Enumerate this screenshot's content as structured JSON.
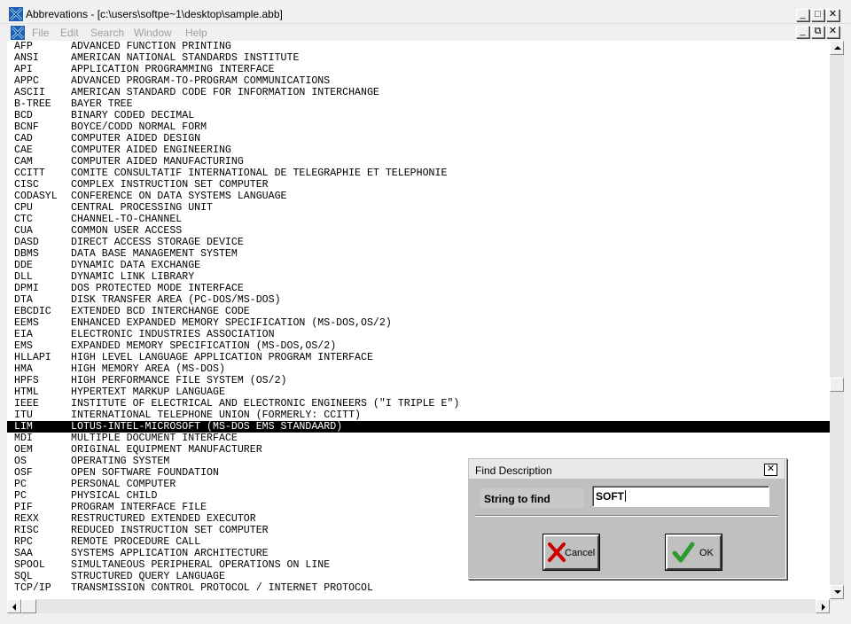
{
  "window": {
    "title": "Abbrevations - [c:\\users\\softpe~1\\desktop\\sample.abb]",
    "buttons": [
      "_",
      "□",
      "✕"
    ]
  },
  "menu": {
    "items": [
      "File",
      "Edit",
      "Search",
      "Window",
      "Help"
    ],
    "child_buttons": [
      "_",
      "⧉",
      "✕"
    ]
  },
  "entries": [
    {
      "abbr": "AFP",
      "desc": "ADVANCED FUNCTION PRINTING"
    },
    {
      "abbr": "ANSI",
      "desc": "AMERICAN NATIONAL STANDARDS INSTITUTE"
    },
    {
      "abbr": "API",
      "desc": "APPLICATION PROGRAMMING INTERFACE"
    },
    {
      "abbr": "APPC",
      "desc": "ADVANCED PROGRAM-TO-PROGRAM COMMUNICATIONS"
    },
    {
      "abbr": "ASCII",
      "desc": "AMERICAN STANDARD CODE FOR INFORMATION INTERCHANGE"
    },
    {
      "abbr": "B-TREE",
      "desc": "BAYER TREE"
    },
    {
      "abbr": "BCD",
      "desc": "BINARY CODED DECIMAL"
    },
    {
      "abbr": "BCNF",
      "desc": "BOYCE/CODD NORMAL FORM"
    },
    {
      "abbr": "CAD",
      "desc": "COMPUTER AIDED DESIGN"
    },
    {
      "abbr": "CAE",
      "desc": "COMPUTER AIDED ENGINEERING"
    },
    {
      "abbr": "CAM",
      "desc": "COMPUTER AIDED MANUFACTURING"
    },
    {
      "abbr": "CCITT",
      "desc": "COMITE CONSULTATIF INTERNATIONAL DE TELEGRAPHIE ET TELEPHONIE"
    },
    {
      "abbr": "CISC",
      "desc": "COMPLEX INSTRUCTION SET COMPUTER"
    },
    {
      "abbr": "CODASYL",
      "desc": "CONFERENCE ON DATA SYSTEMS LANGUAGE"
    },
    {
      "abbr": "CPU",
      "desc": "CENTRAL PROCESSING UNIT"
    },
    {
      "abbr": "CTC",
      "desc": "CHANNEL-TO-CHANNEL"
    },
    {
      "abbr": "CUA",
      "desc": "COMMON USER ACCESS"
    },
    {
      "abbr": "DASD",
      "desc": "DIRECT ACCESS STORAGE DEVICE"
    },
    {
      "abbr": "DBMS",
      "desc": "DATA BASE MANAGEMENT SYSTEM"
    },
    {
      "abbr": "DDE",
      "desc": "DYNAMIC DATA EXCHANGE"
    },
    {
      "abbr": "DLL",
      "desc": "DYNAMIC LINK LIBRARY"
    },
    {
      "abbr": "DPMI",
      "desc": "DOS PROTECTED MODE INTERFACE"
    },
    {
      "abbr": "DTA",
      "desc": "DISK TRANSFER AREA (PC-DOS/MS-DOS)"
    },
    {
      "abbr": "EBCDIC",
      "desc": "EXTENDED BCD INTERCHANGE CODE"
    },
    {
      "abbr": "EEMS",
      "desc": "ENHANCED EXPANDED MEMORY SPECIFICATION (MS-DOS,OS/2)"
    },
    {
      "abbr": "EIA",
      "desc": "ELECTRONIC INDUSTRIES ASSOCIATION"
    },
    {
      "abbr": "EMS",
      "desc": "EXPANDED MEMORY SPECIFICATION (MS-DOS,OS/2)"
    },
    {
      "abbr": "HLLAPI",
      "desc": "HIGH LEVEL LANGUAGE APPLICATION PROGRAM INTERFACE"
    },
    {
      "abbr": "HMA",
      "desc": "HIGH MEMORY AREA (MS-DOS)"
    },
    {
      "abbr": "HPFS",
      "desc": "HIGH PERFORMANCE FILE SYSTEM (OS/2)"
    },
    {
      "abbr": "HTML",
      "desc": "HYPERTEXT MARKUP LANGUAGE"
    },
    {
      "abbr": "IEEE",
      "desc": "INSTITUTE OF ELECTRICAL AND ELECTRONIC ENGINEERS (\"I TRIPLE E\")"
    },
    {
      "abbr": "ITU",
      "desc": "INTERNATIONAL TELEPHONE UNION (FORMERLY: CCITT)"
    },
    {
      "abbr": "LIM",
      "desc": "LOTUS-INTEL-MICROSOFT (MS-DOS EMS STANDAARD)",
      "selected": true
    },
    {
      "abbr": "MDI",
      "desc": "MULTIPLE DOCUMENT INTERFACE"
    },
    {
      "abbr": "OEM",
      "desc": "ORIGINAL EQUIPMENT MANUFACTURER"
    },
    {
      "abbr": "OS",
      "desc": "OPERATING SYSTEM"
    },
    {
      "abbr": "OSF",
      "desc": "OPEN SOFTWARE FOUNDATION"
    },
    {
      "abbr": "PC",
      "desc": "PERSONAL COMPUTER"
    },
    {
      "abbr": "PC",
      "desc": "PHYSICAL CHILD"
    },
    {
      "abbr": "PIF",
      "desc": "PROGRAM INTERFACE FILE"
    },
    {
      "abbr": "REXX",
      "desc": "RESTRUCTURED EXTENDED EXECUTOR"
    },
    {
      "abbr": "RISC",
      "desc": "REDUCED INSTRUCTION SET COMPUTER"
    },
    {
      "abbr": "RPC",
      "desc": "REMOTE PROCEDURE CALL"
    },
    {
      "abbr": "SAA",
      "desc": "SYSTEMS APPLICATION ARCHITECTURE"
    },
    {
      "abbr": "SPOOL",
      "desc": "SIMULTANEOUS PERIPHERAL OPERATIONS ON LINE"
    },
    {
      "abbr": "SQL",
      "desc": "STRUCTURED QUERY LANGUAGE"
    },
    {
      "abbr": "TCP/IP",
      "desc": "TRANSMISSION CONTROL PROTOCOL / INTERNET PROTOCOL"
    }
  ],
  "dialog": {
    "title": "Find Description",
    "close": "✕",
    "field_label": "String to find",
    "field_value": "SOFT",
    "cancel_label": "Cancel",
    "ok_label": "OK"
  },
  "icons": {
    "app": "abbreviations-app-icon",
    "cancel": "red-x-icon",
    "ok": "green-check-icon"
  },
  "colors": {
    "selection_bg": "#000000",
    "selection_fg": "#ffffff",
    "cancel_icon": "#cc0000",
    "ok_icon": "#2e9a2e"
  }
}
